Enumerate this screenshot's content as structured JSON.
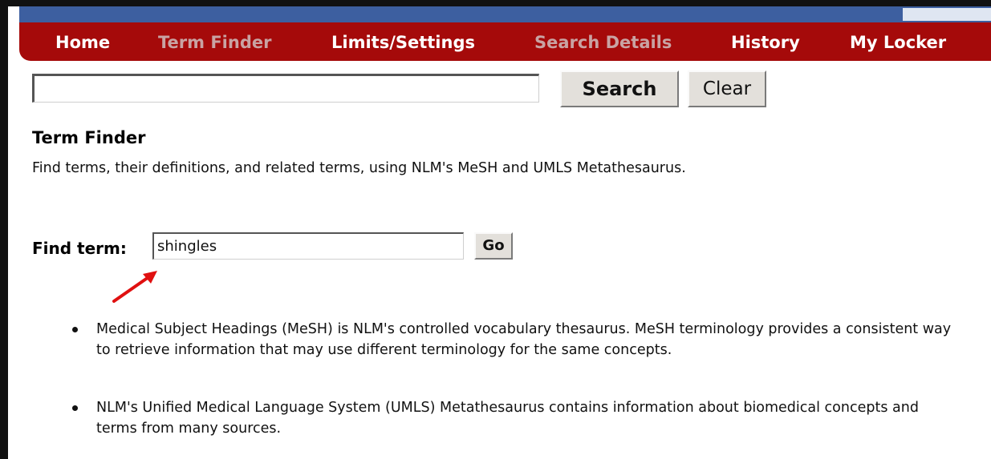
{
  "nav": {
    "items": [
      {
        "label": "Home",
        "active": true
      },
      {
        "label": "Term Finder",
        "active": false
      },
      {
        "label": "Limits/Settings",
        "active": true
      },
      {
        "label": "Search Details",
        "active": false
      },
      {
        "label": "History",
        "active": true
      },
      {
        "label": "My Locker",
        "active": true
      }
    ]
  },
  "search": {
    "value": "",
    "search_label": "Search",
    "clear_label": "Clear"
  },
  "term_finder": {
    "heading": "Term Finder",
    "description": "Find terms, their definitions, and related terms, using NLM's MeSH and UMLS Metathesaurus.",
    "find_label": "Find term:",
    "find_value": "shingles",
    "go_label": "Go"
  },
  "info": {
    "items": [
      "Medical Subject Headings (MeSH) is NLM's controlled vocabulary thesaurus. MeSH terminology provides a consistent way to retrieve information that may use different terminology for the same concepts.",
      "NLM's Unified Medical Language System (UMLS) Metathesaurus contains information about biomedical concepts and terms from many sources."
    ]
  },
  "colors": {
    "nav_bg": "#a50a0a",
    "nav_text": "#ffffff",
    "nav_dim_text": "#c9a3a3",
    "annotation_arrow": "#e01010"
  }
}
